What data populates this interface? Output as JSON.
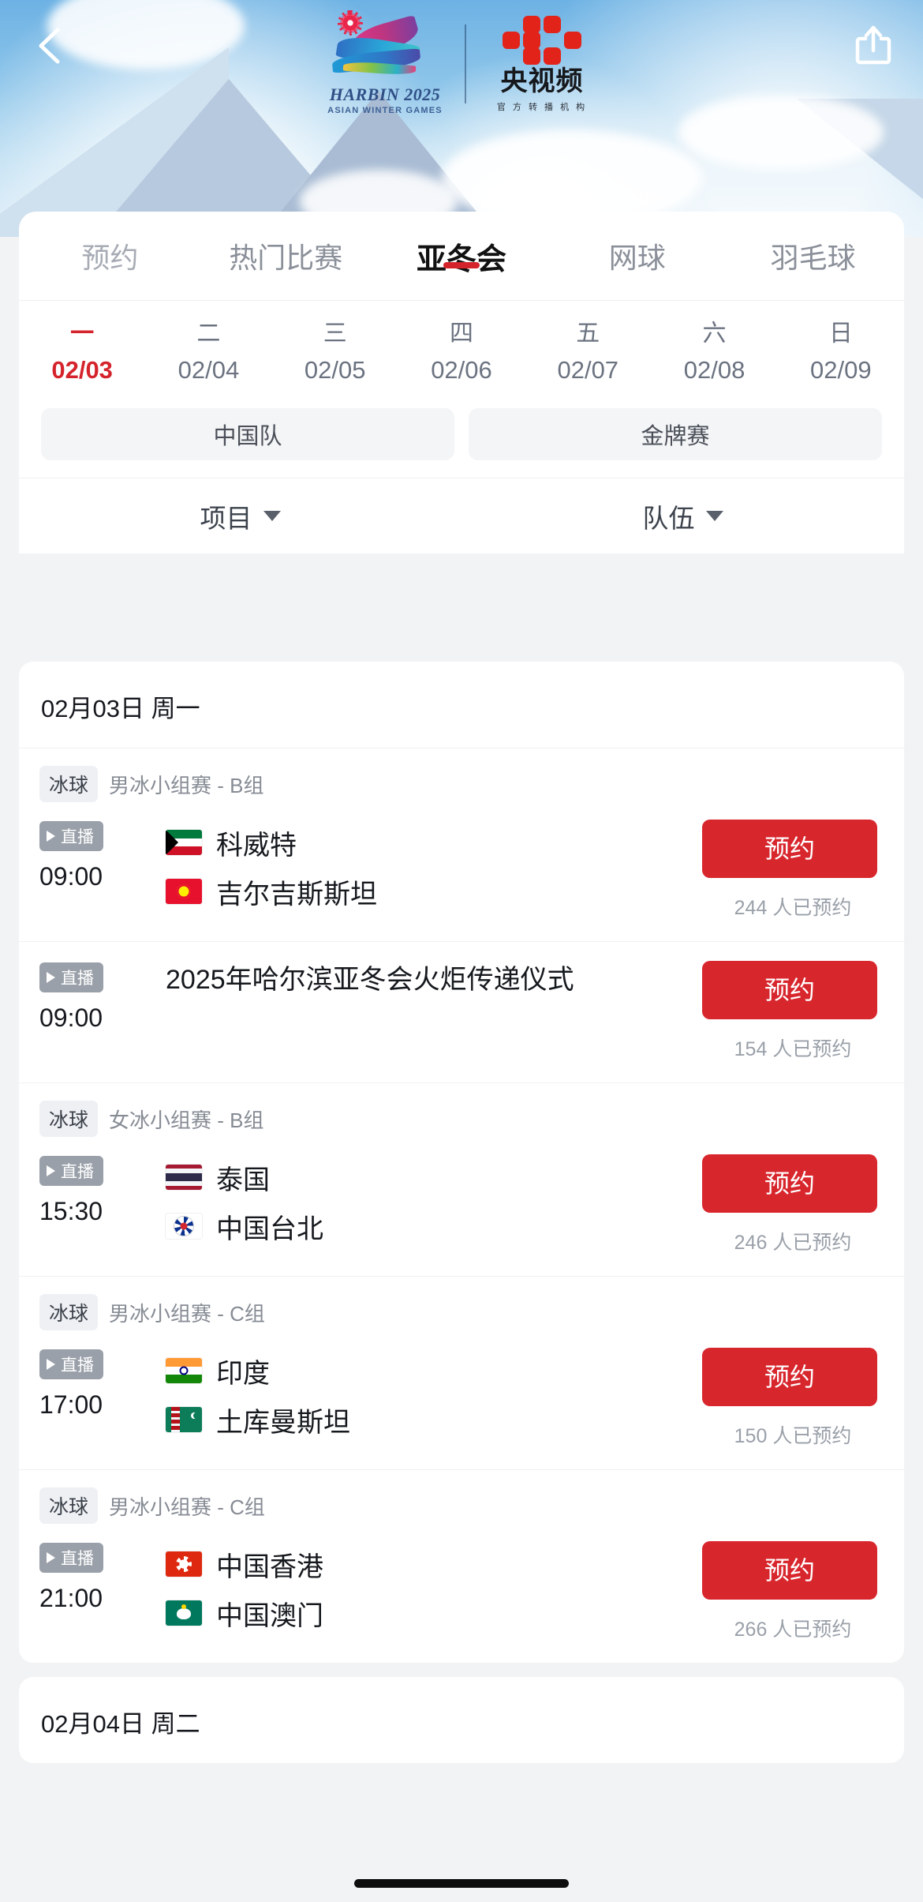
{
  "header": {
    "back_icon": "back-chevron-icon",
    "share_icon": "share-icon",
    "harbin_logo": {
      "title": "HARBIN 2025",
      "subtitle": "ASIAN WINTER GAMES",
      "mark": "harbin-2025-emblem-icon"
    },
    "broadcaster_logo": {
      "name": "央视频",
      "subtitle": "官 方 转 播 机 构",
      "mark": "yangshipin-logo-icon"
    }
  },
  "tabs": [
    {
      "label": "预约",
      "active": false
    },
    {
      "label": "热门比赛",
      "active": false
    },
    {
      "label": "亚冬会",
      "active": true
    },
    {
      "label": "网球",
      "active": false
    },
    {
      "label": "羽毛球",
      "active": false
    }
  ],
  "dates": [
    {
      "dow": "一",
      "date": "02/03",
      "active": true
    },
    {
      "dow": "二",
      "date": "02/04",
      "active": false
    },
    {
      "dow": "三",
      "date": "02/05",
      "active": false
    },
    {
      "dow": "四",
      "date": "02/06",
      "active": false
    },
    {
      "dow": "五",
      "date": "02/07",
      "active": false
    },
    {
      "dow": "六",
      "date": "02/08",
      "active": false
    },
    {
      "dow": "日",
      "date": "02/09",
      "active": false
    }
  ],
  "chips": [
    {
      "label": "中国队"
    },
    {
      "label": "金牌赛"
    }
  ],
  "filters": [
    {
      "label": "项目",
      "icon": "chevron-down-icon"
    },
    {
      "label": "队伍",
      "icon": "chevron-down-icon"
    }
  ],
  "days": [
    {
      "header": "02月03日 周一",
      "matches": [
        {
          "sport": "冰球",
          "stage": "男冰小组赛 - B组",
          "live_label": "直播",
          "time": "09:00",
          "type": "teams",
          "teams": [
            {
              "name": "科威特",
              "flag": "kuwait-flag-icon"
            },
            {
              "name": "吉尔吉斯斯坦",
              "flag": "kyrgyzstan-flag-icon"
            }
          ],
          "button": "预约",
          "count": "244 人已预约"
        },
        {
          "sport": "",
          "stage": "",
          "live_label": "直播",
          "time": "09:00",
          "type": "event",
          "title": "2025年哈尔滨亚冬会火炬传递仪式",
          "button": "预约",
          "count": "154 人已预约"
        },
        {
          "sport": "冰球",
          "stage": "女冰小组赛 - B组",
          "live_label": "直播",
          "time": "15:30",
          "type": "teams",
          "teams": [
            {
              "name": "泰国",
              "flag": "thailand-flag-icon"
            },
            {
              "name": "中国台北",
              "flag": "chinese-taipei-flag-icon"
            }
          ],
          "button": "预约",
          "count": "246 人已预约"
        },
        {
          "sport": "冰球",
          "stage": "男冰小组赛 - C组",
          "live_label": "直播",
          "time": "17:00",
          "type": "teams",
          "teams": [
            {
              "name": "印度",
              "flag": "india-flag-icon"
            },
            {
              "name": "土库曼斯坦",
              "flag": "turkmenistan-flag-icon"
            }
          ],
          "button": "预约",
          "count": "150 人已预约"
        },
        {
          "sport": "冰球",
          "stage": "男冰小组赛 - C组",
          "live_label": "直播",
          "time": "21:00",
          "type": "teams",
          "teams": [
            {
              "name": "中国香港",
              "flag": "hong-kong-flag-icon"
            },
            {
              "name": "中国澳门",
              "flag": "macau-flag-icon"
            }
          ],
          "button": "预约",
          "count": "266 人已预约"
        }
      ]
    },
    {
      "header": "02月04日 周二",
      "matches": []
    }
  ],
  "colors": {
    "accent_red": "#d5232b",
    "button_red": "#d8262d",
    "muted": "#8a8f99"
  }
}
